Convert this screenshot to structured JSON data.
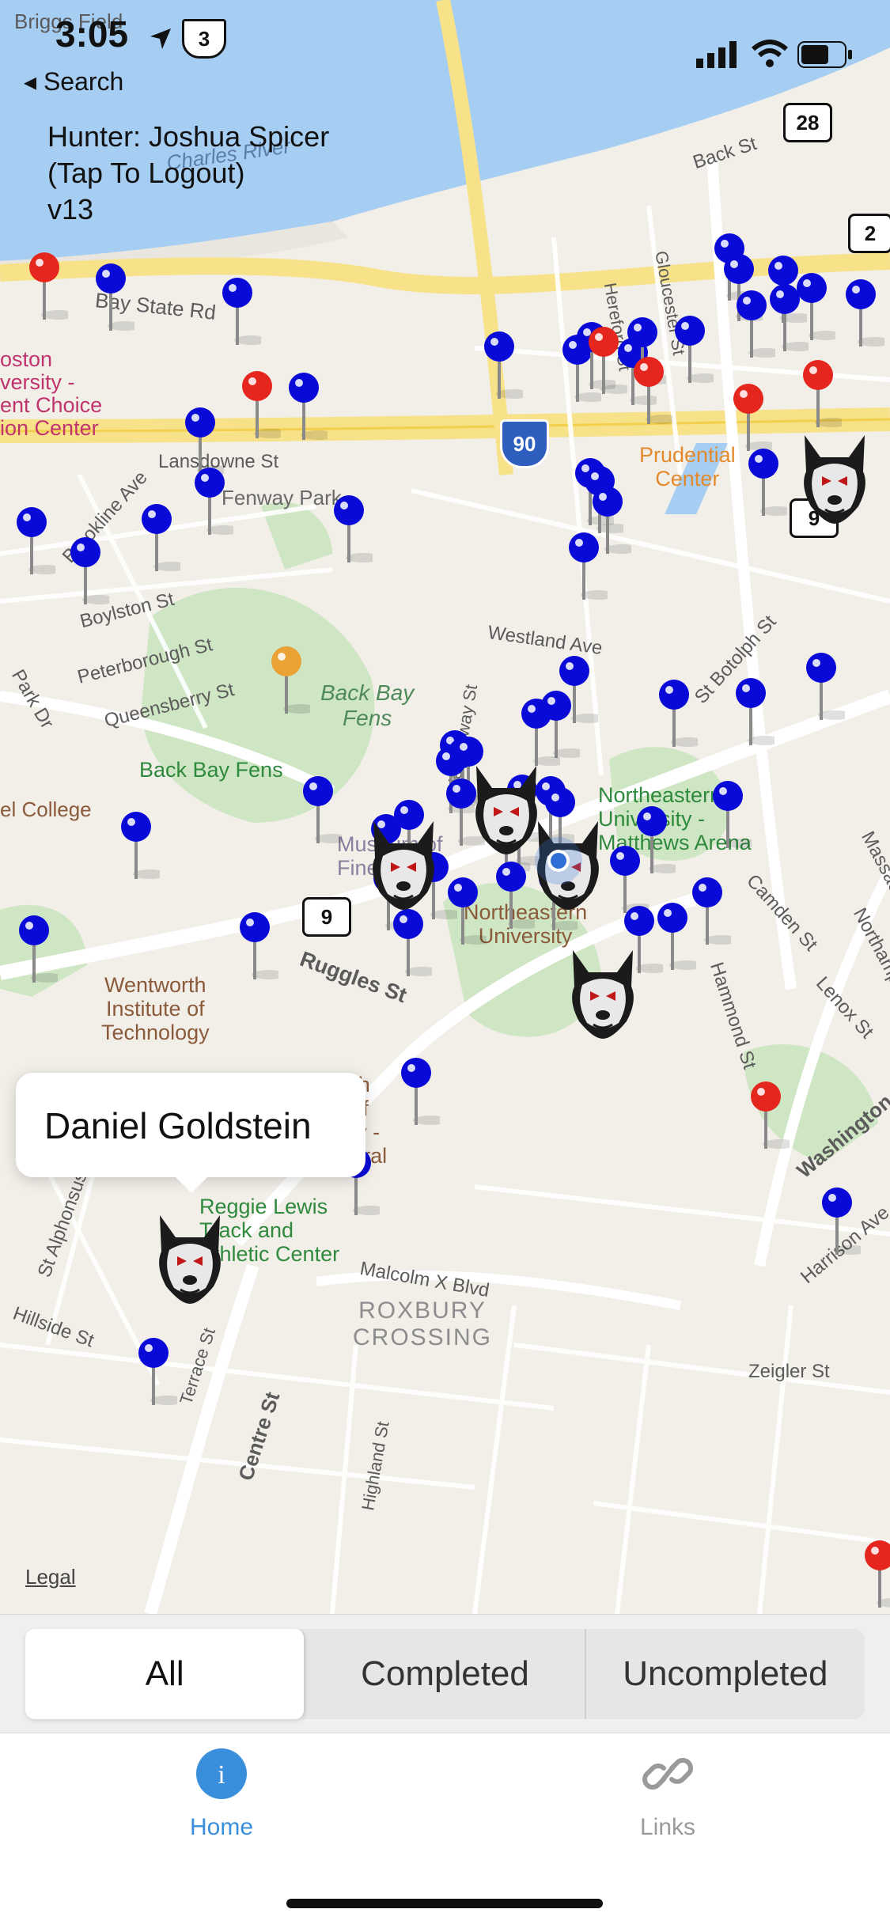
{
  "status_bar": {
    "time": "3:05",
    "back_label": "◂ Search"
  },
  "hunter": {
    "line1": "Hunter: Joshua Spicer",
    "line2": "(Tap To Logout)",
    "line3": "v13"
  },
  "map": {
    "labels": {
      "briggs_field": "Briggs Field",
      "charles_river": "Charles River",
      "back_st": "Back St",
      "bay_state_rd": "Bay State Rd",
      "boston_univ_1": "oston",
      "boston_univ_2": "versity -",
      "boston_univ_3": "ent Choice",
      "boston_univ_4": "ion Center",
      "lansdowne": "Lansdowne St",
      "fenway_park": "Fenway Park",
      "brookline_ave": "Brookline Ave",
      "boylston": "Boylston St",
      "peterborough": "Peterborough St",
      "queensberry": "Queensberry St",
      "park_dr": "Park Dr",
      "back_bay_fens_1": "Back Bay",
      "back_bay_fens_2": "Fens",
      "back_bay_fens_park": "Back Bay Fens",
      "college": "el College",
      "westland": "Westland Ave",
      "hemenway": "Hemenway St",
      "gloucester": "Gloucester St",
      "hereford": "Hereford St",
      "prudential_1": "Prudential",
      "prudential_2": "Center",
      "botolph": "St Botolph St",
      "northeastern_arena_1": "Northeastern",
      "northeastern_arena_2": "University -",
      "northeastern_arena_3": "Matthews Arena",
      "museum_1": "Museum of",
      "museum_2": "Fine",
      "northeastern_univ_1": "Northeastern",
      "northeastern_univ_2": "University",
      "camden": "Camden St",
      "massachusetts": "Massachusetts Ave",
      "northampton": "Northampton St",
      "lenox": "Lenox St",
      "hammond": "Hammond St",
      "wentworth_1": "Wentworth",
      "wentworth_2": "Institute of",
      "wentworth_3": "Technology",
      "ruggles": "Ruggles St",
      "wentworth_annex_1": "Wentworth",
      "wentworth_annex_2": "Institute of",
      "wentworth_annex_3": "Technology -",
      "wentworth_annex_4": "Annex Central",
      "washington": "Washington St",
      "harrison": "Harrison Ave",
      "reggie_1": "Reggie Lewis",
      "reggie_2": "Track and",
      "reggie_3": "Athletic Center",
      "malcolm_x": "Malcolm X Blvd",
      "st_alphonsus": "St Alphonsus St",
      "hillside": "Hillside St",
      "terrace": "Terrace St",
      "roxbury_1": "ROXBURY",
      "roxbury_2": "CROSSING",
      "zeigler": "Zeigler St",
      "centre": "Centre St",
      "highland": "Highland St",
      "legal": "Legal"
    },
    "route_shields": {
      "us3": "3",
      "r28": "28",
      "r2": "2",
      "i90": "90",
      "r9a": "9",
      "r9b": "9"
    }
  },
  "callout": {
    "name": "Daniel Goldstein"
  },
  "segments": {
    "all": "All",
    "completed": "Completed",
    "uncompleted": "Uncompleted"
  },
  "tabs": {
    "home": "Home",
    "links": "Links"
  },
  "colors": {
    "blue_pin": "#0a0ad8",
    "red_pin": "#e4261e",
    "orange_pin": "#e9a233",
    "tab_active": "#3a8fdc"
  }
}
